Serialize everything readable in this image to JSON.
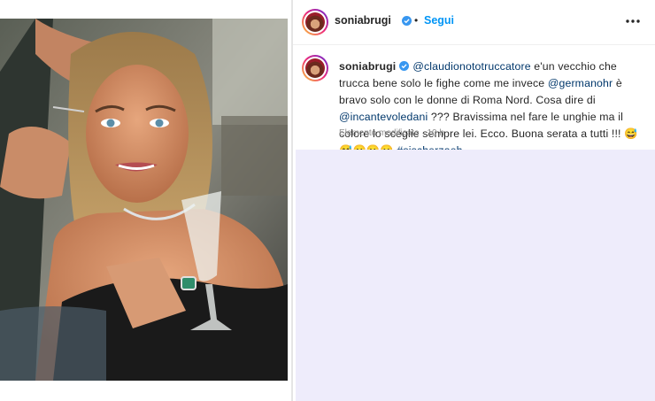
{
  "post": {
    "username": "soniabrugi",
    "follow_label": "Segui",
    "dot": "•",
    "caption": {
      "username": "soniabrugi",
      "mention1": "@claudionototruccatore",
      "text1": " e'un vecchio che trucca bene solo le fighe come me invece ",
      "mention2": "@germanohr",
      "text2": " è bravo solo con le donne di Roma Nord. Cosa dire di ",
      "mention3": "@incantevoledani",
      "text3": " ??? Bravissima nel fare le unghie ma il colore lo sceglie sempre lei. Ecco. Buona serata a tutti !!! 😅😅😛😛😛 ",
      "hashtag": "#sischerzaeh"
    },
    "edited_label": "Elemento modificato",
    "meta_separator": " · ",
    "time": "10 h"
  },
  "icons": {
    "verified": "verified-badge-icon",
    "more": "more-options-icon"
  },
  "colors": {
    "link": "#0095f6",
    "mention": "#00376b",
    "verified": "#3897f0",
    "empty_area": "#eeecfb"
  }
}
